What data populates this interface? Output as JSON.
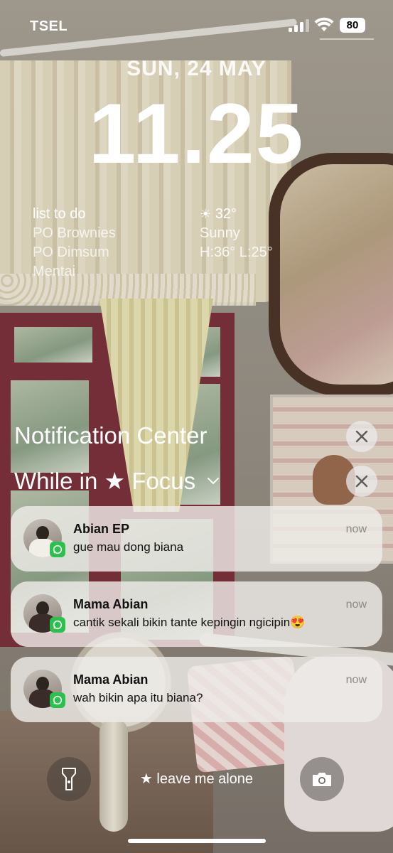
{
  "status_bar": {
    "carrier": "TSEL",
    "battery": "80",
    "icons": [
      "signal-icon",
      "wifi-icon",
      "battery-icon"
    ]
  },
  "lock_screen": {
    "date": "SUN, 24 MAY",
    "time": "11.25"
  },
  "widgets": {
    "todo": {
      "title": "list to do",
      "items": [
        "PO Brownies",
        "PO Dimsum",
        "Mentai"
      ]
    },
    "weather": {
      "icon": "sun-icon",
      "temperature": "32°",
      "condition": "Sunny",
      "high_low": "H:36° L:25°"
    }
  },
  "notification_center": {
    "title": "Notification Center",
    "focus_label": "While in ★ Focus"
  },
  "notifications": [
    {
      "sender": "Abian EP",
      "message": "gue mau dong biana",
      "time": "now",
      "app_icon": "whatsapp-icon"
    },
    {
      "sender": "Mama Abian",
      "message": "cantik sekali bikin tante kepingin ngicipin😍",
      "time": "now",
      "app_icon": "whatsapp-icon"
    },
    {
      "sender": "Mama Abian",
      "message": "wah bikin apa itu biana?",
      "time": "now",
      "app_icon": "whatsapp-icon"
    }
  ],
  "bottom": {
    "focus_mode": "★ leave me alone",
    "left_button_icon": "flashlight-icon",
    "right_button_icon": "camera-icon"
  },
  "colors": {
    "notification_bg": "#eeece8",
    "whatsapp": "#2cc04c",
    "timestamp": "#8d8a86"
  }
}
